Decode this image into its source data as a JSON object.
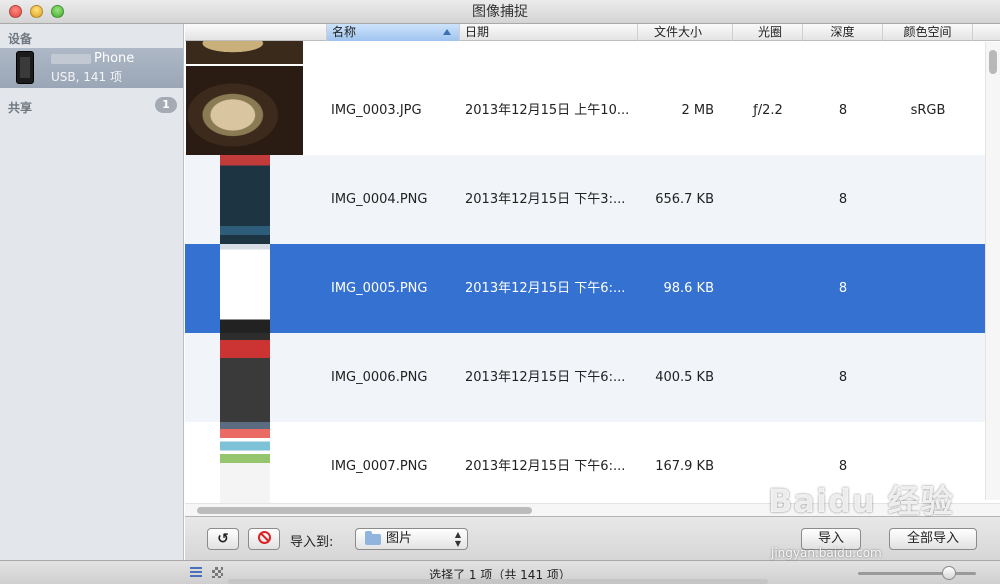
{
  "window": {
    "title": "图像捕捉"
  },
  "sidebar": {
    "devices_label": "设备",
    "device": {
      "name": "Phone",
      "subtitle": "USB, 141 项"
    },
    "shared_label": "共享",
    "shared_count": "1"
  },
  "table": {
    "columns": [
      "名称",
      "日期",
      "文件大小",
      "光圈",
      "深度",
      "颜色空间"
    ],
    "rows": [
      {
        "name": "IMG_0003.JPG",
        "date": "2013年12月15日 上午10...",
        "size": "2 MB",
        "aperture": "ƒ/2.2",
        "depth": "8",
        "color_space": "sRGB",
        "selected": false
      },
      {
        "name": "IMG_0004.PNG",
        "date": "2013年12月15日 下午3:...",
        "size": "656.7 KB",
        "aperture": "",
        "depth": "8",
        "color_space": "",
        "selected": false
      },
      {
        "name": "IMG_0005.PNG",
        "date": "2013年12月15日 下午6:...",
        "size": "98.6 KB",
        "aperture": "",
        "depth": "8",
        "color_space": "",
        "selected": true
      },
      {
        "name": "IMG_0006.PNG",
        "date": "2013年12月15日 下午6:...",
        "size": "400.5 KB",
        "aperture": "",
        "depth": "8",
        "color_space": "",
        "selected": false
      },
      {
        "name": "IMG_0007.PNG",
        "date": "2013年12月15日 下午6:...",
        "size": "167.9 KB",
        "aperture": "",
        "depth": "8",
        "color_space": "",
        "selected": false
      }
    ]
  },
  "toolbar": {
    "rotate_label": "↺",
    "import_to_label": "导入到:",
    "destination": "图片",
    "import_label": "导入",
    "import_all_label": "全部导入"
  },
  "status": {
    "text": "选择了 1 项（共 141 项）"
  },
  "watermark": {
    "text": "Baidu 经验",
    "sub": "jingyan.baidu.com"
  },
  "colors": {
    "selection": "#3471d0",
    "sidebar": "#e3e7ec"
  }
}
